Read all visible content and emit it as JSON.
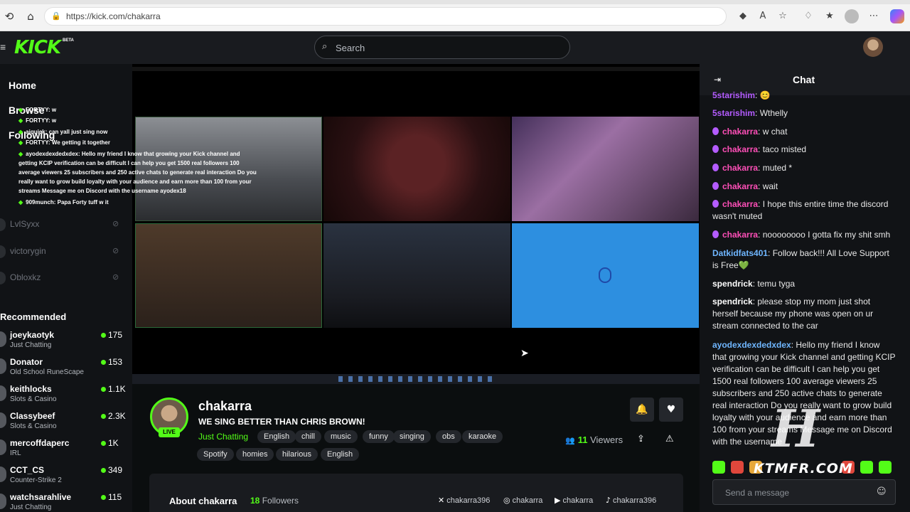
{
  "browser": {
    "url": "https://kick.com/chakarra",
    "icons": [
      "back-icon",
      "home-icon",
      "lock-icon",
      "extension-icon",
      "read-aloud-icon",
      "favorite-icon",
      "collections-icon",
      "favorites-bar-icon",
      "profile-icon",
      "more-icon",
      "copilot-icon"
    ]
  },
  "header": {
    "logo": "KICK",
    "beta": "BETA",
    "search_placeholder": "Search"
  },
  "sidebar": {
    "home": "Home",
    "browse": "Browse",
    "following": "Following",
    "followed": [
      {
        "name": "LvlSyxx"
      },
      {
        "name": "victorygin"
      },
      {
        "name": "Obloxkz"
      }
    ],
    "recommended_title": "Recommended",
    "recommended": [
      {
        "name": "joeykaotyk",
        "category": "Just Chatting",
        "viewers": "175"
      },
      {
        "name": "Donator",
        "category": "Old School RuneScape",
        "viewers": "153"
      },
      {
        "name": "keithlocks",
        "category": "Slots & Casino",
        "viewers": "1.1K"
      },
      {
        "name": "Classybeef",
        "category": "Slots & Casino",
        "viewers": "2.3K"
      },
      {
        "name": "mercoffdaperc",
        "category": "IRL",
        "viewers": "1K"
      },
      {
        "name": "CCT_CS",
        "category": "Counter-Strike 2",
        "viewers": "349"
      },
      {
        "name": "watchsarahlive",
        "category": "Just Chatting",
        "viewers": "115"
      }
    ]
  },
  "overlay_chat": [
    {
      "user": "FORTYY",
      "text": ": w"
    },
    {
      "user": "FORTYY",
      "text": ": w"
    },
    {
      "user": "ajquick",
      "text": ": can yall just sing now"
    },
    {
      "user": "FORTYY",
      "text": ": We getting it together"
    },
    {
      "user": "ayodexdexdedxdex",
      "text": ": Hello my friend I know that growing your Kick channel and"
    },
    {
      "user": "",
      "text": "getting KCIP verification can be difficult I can help you get 1500 real followers 100"
    },
    {
      "user": "",
      "text": "average viewers 25 subscribers and 250 active chats to generate real interaction Do you"
    },
    {
      "user": "",
      "text": "really want to grow build loyalty with your audience and earn more than 100 from your"
    },
    {
      "user": "",
      "text": "streams Message me on Discord with the username ayodex18"
    },
    {
      "user": "909munch",
      "text": ": Papa Forty tuff w it"
    }
  ],
  "stream": {
    "channel": "chakarra",
    "title": "WE SING BETTER THAN CHRIS BROWN!",
    "live": "LIVE",
    "category": "Just Chatting",
    "tags": [
      "English",
      "chill",
      "music",
      "funny",
      "singing",
      "obs",
      "karaoke",
      "Spotify",
      "homies",
      "hilarious",
      "English"
    ],
    "viewers_count": "11",
    "viewers_label": "Viewers"
  },
  "about": {
    "title": "About chakarra",
    "followers_count": "18",
    "followers_label": "Followers",
    "socials": [
      {
        "icon": "x-icon",
        "handle": "chakarra396"
      },
      {
        "icon": "instagram-icon",
        "handle": "chakarra"
      },
      {
        "icon": "youtube-icon",
        "handle": "chakarra"
      },
      {
        "icon": "tiktok-icon",
        "handle": "chakarra396"
      }
    ]
  },
  "chat": {
    "title": "Chat",
    "input_placeholder": "Send a message",
    "messages": [
      {
        "user": "5starishim",
        "text": "😊",
        "color": "#b45cff",
        "badge": false
      },
      {
        "user": "5starishim",
        "text": "Wthelly",
        "color": "#b45cff",
        "badge": false
      },
      {
        "user": "chakarra",
        "text": "w chat",
        "color": "#ff4fb8",
        "badge": true
      },
      {
        "user": "chakarra",
        "text": "taco misted",
        "color": "#ff4fb8",
        "badge": true
      },
      {
        "user": "chakarra",
        "text": "muted *",
        "color": "#ff4fb8",
        "badge": true
      },
      {
        "user": "chakarra",
        "text": "wait",
        "color": "#ff4fb8",
        "badge": true
      },
      {
        "user": "chakarra",
        "text": "I hope this entire time the discord wasn't muted",
        "color": "#ff4fb8",
        "badge": true
      },
      {
        "user": "chakarra",
        "text": "noooooooo I gotta fix my shit smh",
        "color": "#ff4fb8",
        "badge": true
      },
      {
        "user": "Datkidfats401",
        "text": "Follow back!!! All Love Support is Free💚",
        "color": "#6fb6ff",
        "badge": false
      },
      {
        "user": "spendrick",
        "text": "temu tyga",
        "color": "#ffffff",
        "badge": false
      },
      {
        "user": "spendrick",
        "text": "please stop my mom just shot herself because my phone was open on ur stream connected to the car",
        "color": "#ffffff",
        "badge": false
      },
      {
        "user": "ayodexdexdedxdex",
        "text": "Hello my friend I know that growing your Kick channel and getting KCIP verification can be difficult I can help you get 1500 real followers 100 average viewers 25 subscribers and 250 active chats to generate real interaction Do you really want to grow build loyalty with your audience and earn more than 100 from your streams Message me on Discord with the username",
        "color": "#6fb6ff",
        "badge": false
      }
    ]
  },
  "watermark": {
    "mark": "H",
    "text": "KTMFR.COM"
  },
  "colors": {
    "accent": "#53fc18",
    "bg": "#0b0e0f",
    "panel": "#191b1f"
  }
}
